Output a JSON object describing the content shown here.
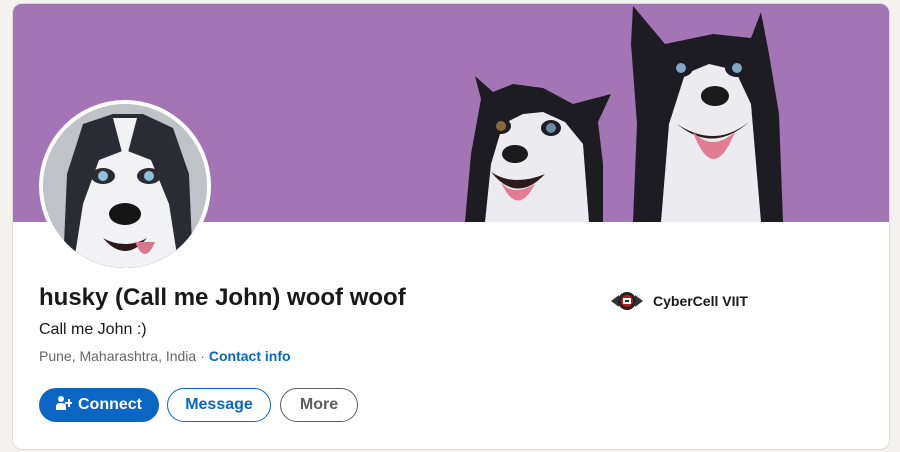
{
  "profile": {
    "name": "husky (Call me John) woof woof",
    "headline": "Call me John :)",
    "location": "Pune, Maharashtra, India",
    "separator": "·",
    "contact_info_label": "Contact info"
  },
  "organization": {
    "name": "CyberCell VIIT"
  },
  "actions": {
    "connect_label": "Connect",
    "message_label": "Message",
    "more_label": "More"
  },
  "colors": {
    "cover_bg": "#a375b5",
    "primary_blue": "#0a66c2"
  }
}
